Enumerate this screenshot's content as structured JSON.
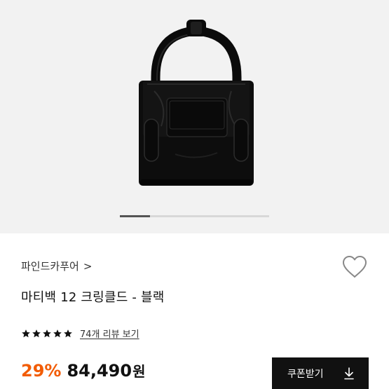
{
  "gallery": {
    "image_icon": "handbag-product-image",
    "pager_total": 5,
    "pager_current": 1
  },
  "product": {
    "brand": "파인드카푸어",
    "brand_chevron": ">",
    "title": "마티백 12 크링클드 - 블랙",
    "rating_stars": 5,
    "review_link": "74개 리뷰 보기",
    "discount": "29%",
    "price": "84,490",
    "currency": "원"
  },
  "actions": {
    "coupon_label": "쿠폰받기",
    "coupon_icon": "download-icon",
    "wishlist_icon": "heart-icon"
  },
  "colors": {
    "discount": "#f25c05",
    "button_bg": "#111111",
    "hero_bg": "#f2f2f2"
  }
}
